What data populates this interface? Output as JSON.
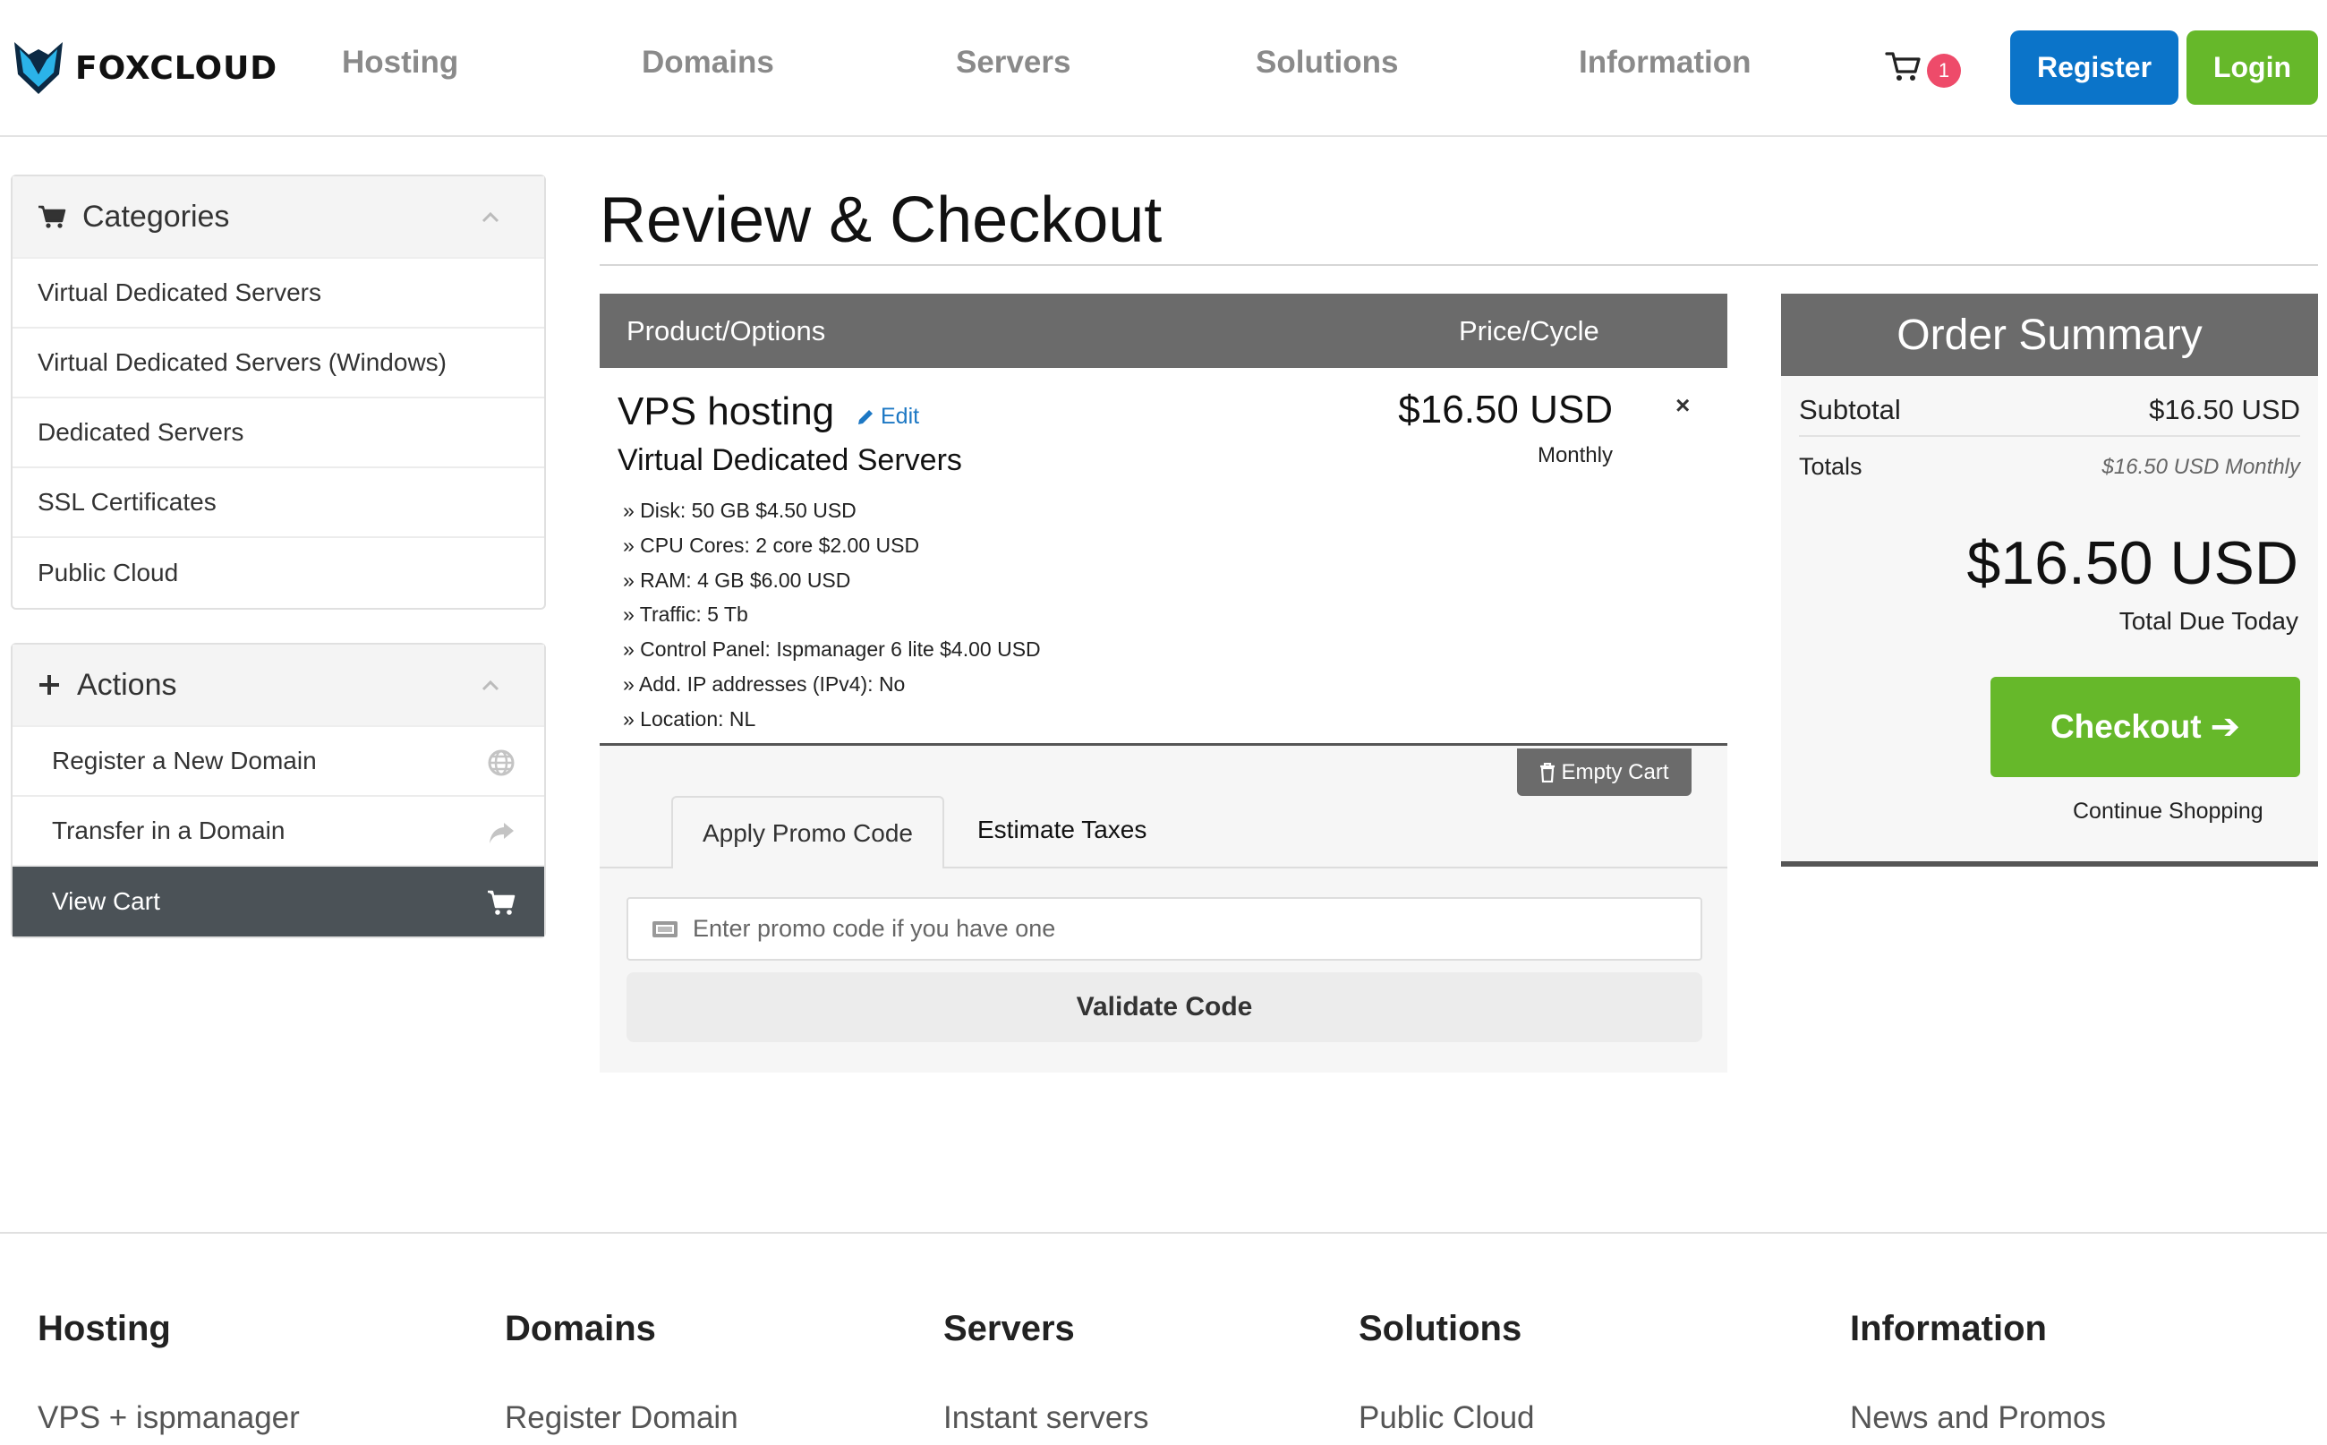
{
  "brand": {
    "name": "FOXCLOUD"
  },
  "nav": {
    "items": [
      "Hosting",
      "Domains",
      "Servers",
      "Solutions",
      "Information"
    ],
    "cart_count": "1",
    "register_label": "Register",
    "login_label": "Login"
  },
  "sidebar": {
    "categories_title": "Categories",
    "categories": [
      "Virtual Dedicated Servers",
      "Virtual Dedicated Servers (Windows)",
      "Dedicated Servers",
      "SSL Certificates",
      "Public Cloud"
    ],
    "actions_title": "Actions",
    "actions": [
      {
        "label": "Register a New Domain",
        "icon": "globe-icon"
      },
      {
        "label": "Transfer in a Domain",
        "icon": "share-arrow-icon"
      },
      {
        "label": "View Cart",
        "icon": "cart-icon"
      }
    ]
  },
  "page": {
    "title": "Review & Checkout"
  },
  "cart": {
    "col_product": "Product/Options",
    "col_price": "Price/Cycle",
    "item": {
      "name": "VPS hosting",
      "edit_label": "Edit",
      "group": "Virtual Dedicated Servers",
      "options": [
        "» Disk: 50 GB $4.50 USD",
        "» CPU Cores: 2 core $2.00 USD",
        "» RAM: 4 GB $6.00 USD",
        "» Traffic: 5 Tb",
        "» Control Panel: Ispmanager 6 lite $4.00 USD",
        "» Add. IP addresses (IPv4): No",
        "» Location: NL"
      ],
      "price": "$16.50 USD",
      "cycle": "Monthly",
      "remove_label": "×"
    },
    "empty_cart_label": "Empty Cart",
    "tabs": {
      "promo": "Apply Promo Code",
      "taxes": "Estimate Taxes"
    },
    "promo_placeholder": "Enter promo code if you have one",
    "validate_label": "Validate Code"
  },
  "summary": {
    "title": "Order Summary",
    "subtotal_label": "Subtotal",
    "subtotal_value": "$16.50 USD",
    "totals_label": "Totals",
    "totals_value": "$16.50 USD Monthly",
    "total_due": "$16.50 USD",
    "total_due_label": "Total Due Today",
    "checkout_label": "Checkout",
    "continue_label": "Continue Shopping"
  },
  "footer": {
    "columns": [
      {
        "heading": "Hosting",
        "link": "VPS + ispmanager"
      },
      {
        "heading": "Domains",
        "link": "Register Domain"
      },
      {
        "heading": "Servers",
        "link": "Instant servers"
      },
      {
        "heading": "Solutions",
        "link": "Public Cloud"
      },
      {
        "heading": "Information",
        "link": "News and Promos"
      }
    ]
  },
  "colors": {
    "register": "#0b74c9",
    "login_checkout": "#66b82a",
    "header_gray": "#6b6b6b",
    "active_sidebar": "#4b5257",
    "badge": "#ee4b6a",
    "link_blue": "#1d78c4"
  }
}
